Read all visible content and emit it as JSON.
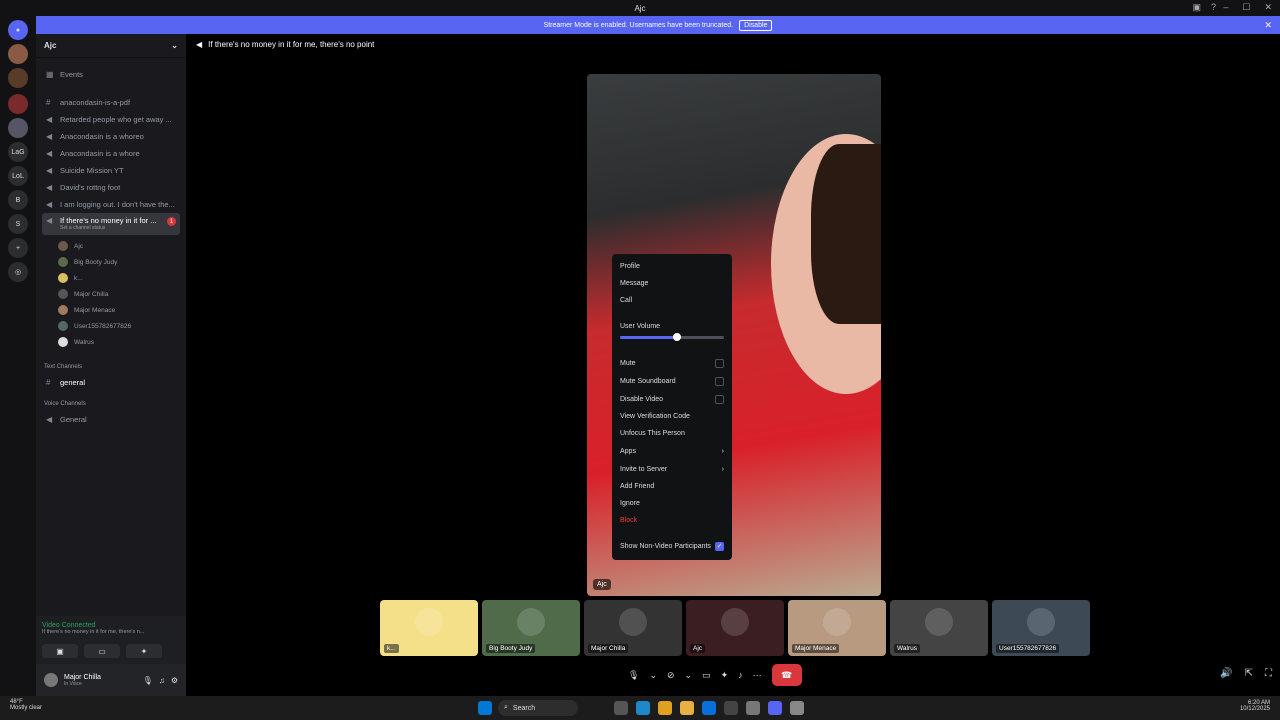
{
  "window": {
    "title": "Ajc",
    "controls": [
      "–",
      "☐",
      "✕"
    ]
  },
  "banner": {
    "text": "Streamer Mode is enabled. Usernames have been truncated.",
    "button": "Disable"
  },
  "guilds": [
    {
      "label": "LaG"
    },
    {
      "label": "LoL"
    },
    {
      "label": "B"
    },
    {
      "label": "S"
    }
  ],
  "server": {
    "name": "Ajc",
    "events": "Events"
  },
  "channels": [
    {
      "name": "anacondasin-is-a-pdf",
      "type": "text"
    },
    {
      "name": "Retarded people who get away ...",
      "type": "voice"
    },
    {
      "name": "Anacondasin is a whoreo",
      "type": "voice"
    },
    {
      "name": "Anacondasin is a whore",
      "type": "voice"
    },
    {
      "name": "Suicide Mission YT",
      "type": "voice"
    },
    {
      "name": "David's rottng foot",
      "type": "voice"
    },
    {
      "name": "I am logging out. I don't have the...",
      "type": "voice"
    },
    {
      "name": "If there's no money in it for ...",
      "type": "voice",
      "selected": true,
      "badge": "1",
      "status": "Set a channel status"
    }
  ],
  "voice_users": [
    "Ajc",
    "Big Booty Judy",
    "k...",
    "Major Chilla",
    "Major Menace",
    "User155782677826",
    "Walrus"
  ],
  "categories": {
    "text": "Text Channels",
    "voice": "Voice Channels"
  },
  "text_channels": [
    "general"
  ],
  "voice_channels": [
    "General"
  ],
  "voice_connected": {
    "status": "Video Connected",
    "channel": "If there's no money in it for me, there's n..."
  },
  "user": {
    "name": "Major Chilla",
    "status": "In Voice"
  },
  "main": {
    "header": "If there's no money in it for me, there's no point",
    "video_label": "Ajc"
  },
  "context_menu": {
    "items": [
      "Profile",
      "Message",
      "Call"
    ],
    "volume_label": "User Volume",
    "volume": 0.55,
    "toggles": [
      {
        "label": "Mute",
        "checked": false
      },
      {
        "label": "Mute Soundboard",
        "checked": false
      },
      {
        "label": "Disable Video",
        "checked": false
      }
    ],
    "actions": [
      "View Verification Code",
      "Unfocus This Person"
    ],
    "submenus": [
      "Apps",
      "Invite to Server"
    ],
    "more": [
      "Add Friend",
      "Ignore"
    ],
    "danger": "Block",
    "show_nonvideo": {
      "label": "Show Non-Video Participants",
      "checked": true
    }
  },
  "tiles": [
    {
      "name": "k...",
      "color": "#f5e08a"
    },
    {
      "name": "Big Booty Judy",
      "color": "#4f6b4a"
    },
    {
      "name": "Major Chilla",
      "color": "#333"
    },
    {
      "name": "Ajc",
      "color": "#3a1e22"
    },
    {
      "name": "Major Menace",
      "color": "#b89a80"
    },
    {
      "name": "Walrus",
      "color": "#444"
    },
    {
      "name": "User155782677826",
      "color": "#3d4a56"
    }
  ],
  "taskbar": {
    "search": "Search",
    "weather_temp": "48°F",
    "weather_desc": "Mostly clear",
    "time": "6:20 AM",
    "date": "10/12/2025"
  }
}
